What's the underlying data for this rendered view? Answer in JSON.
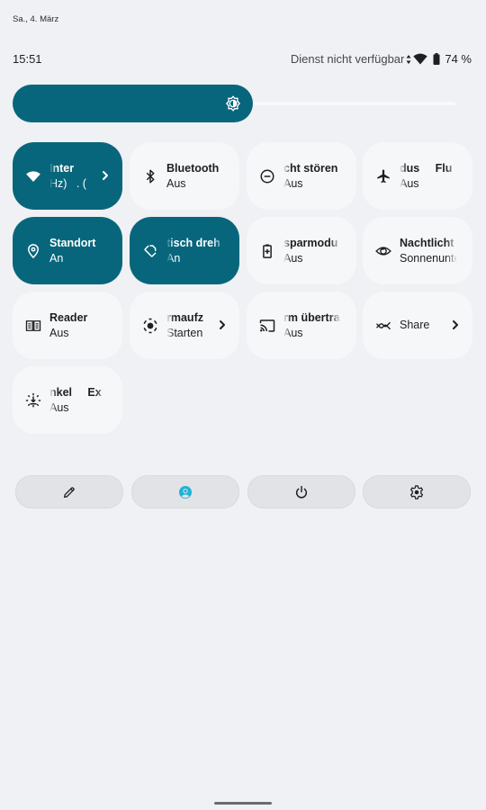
{
  "header": {
    "date": "Sa., 4. März",
    "time": "15:51",
    "network_status": "Dienst nicht verfügbar",
    "battery_percent": "74 %",
    "icons": [
      "data-arrows-icon",
      "wifi-icon",
      "battery-icon"
    ]
  },
  "brightness": {
    "level": 0.5,
    "icon": "brightness-icon",
    "accent_color": "#08667c"
  },
  "tiles": [
    {
      "name": "internet",
      "label": "Inter",
      "sub": "Hz)   . (",
      "icon": "wifi-icon",
      "active": true,
      "chevron": true
    },
    {
      "name": "bluetooth",
      "label": "Bluetooth",
      "sub": "Aus",
      "icon": "bluetooth-icon",
      "active": false,
      "chevron": false
    },
    {
      "name": "do-not-disturb",
      "label": "cht stören",
      "sub": "Aus",
      "icon": "do-not-disturb-icon",
      "active": false,
      "chevron": false
    },
    {
      "name": "airplane-mode",
      "label": "dus     Flu",
      "sub": "Aus",
      "icon": "airplane-icon",
      "active": false,
      "chevron": false
    },
    {
      "name": "location",
      "label": "Standort",
      "sub": "An",
      "icon": "location-pin-icon",
      "active": true,
      "chevron": false
    },
    {
      "name": "auto-rotate",
      "label": "tisch dreh",
      "sub": "An",
      "icon": "rotate-icon",
      "active": true,
      "chevron": false
    },
    {
      "name": "battery-saver",
      "label": "sparmodu",
      "sub": "Aus",
      "icon": "battery-saver-icon",
      "active": false,
      "chevron": false
    },
    {
      "name": "night-light",
      "label": "Nachtlicht",
      "sub": "Sonnenunte",
      "icon": "eye-icon",
      "active": false,
      "chevron": false
    },
    {
      "name": "reader",
      "label": "Reader",
      "sub": "Aus",
      "icon": "reader-icon",
      "active": false,
      "chevron": false
    },
    {
      "name": "screen-record",
      "label": "rmaufz",
      "sub": "Starten",
      "icon": "screen-record-icon",
      "active": false,
      "chevron": true
    },
    {
      "name": "screen-cast",
      "label": "rm übertra",
      "sub": "Aus",
      "icon": "cast-icon",
      "active": false,
      "chevron": false
    },
    {
      "name": "nearby-share",
      "label": "Share",
      "sub": "",
      "icon": "nearby-share-icon",
      "active": false,
      "chevron": true
    },
    {
      "name": "extra-dim",
      "label": "nkel     Ex",
      "sub": "Aus",
      "icon": "extra-dim-icon",
      "active": false,
      "chevron": false
    }
  ],
  "bottom_buttons": [
    {
      "name": "edit",
      "icon": "pencil-icon"
    },
    {
      "name": "user",
      "icon": "user-icon",
      "color": "#1fb3d6"
    },
    {
      "name": "power",
      "icon": "power-icon"
    },
    {
      "name": "settings",
      "icon": "gear-icon"
    }
  ]
}
